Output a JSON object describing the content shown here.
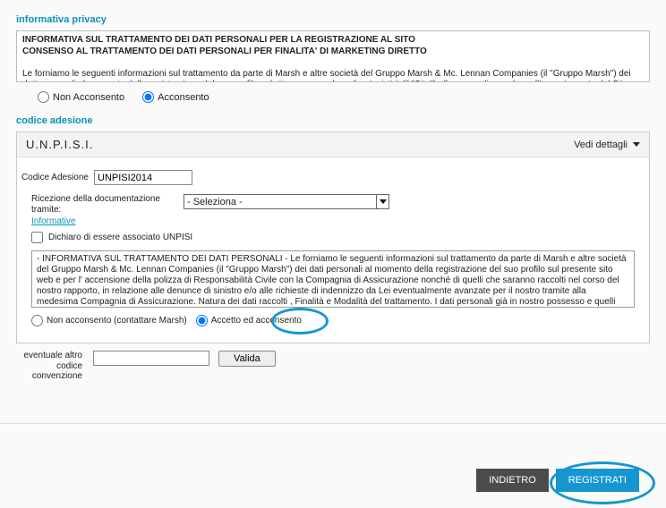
{
  "privacy_section": {
    "title": "informativa privacy",
    "heading1": "INFORMATIVA SUL TRATTAMENTO DEI DATI PERSONALI PER LA REGISTRAZIONE AL SITO",
    "heading2": "CONSENSO AL TRATTAMENTO DEI DATI PERSONALI PER FINALITA' DI MARKETING DIRETTO",
    "body": "Le forniamo le seguenti informazioni sul trattamento da parte di Marsh e altre società del Gruppo Marsh & Mc. Lennan Companies (il \"Gruppo Marsh\") dei dati personali al momento della registrazione del suo profilo sul sito www.marsh-professionisti.it (il \"Sito\") allo scopo di accedere all'area riservata del Sito e ottenere",
    "opt_no": "Non Acconsento",
    "opt_yes": "Acconsento"
  },
  "adesione_section": {
    "title": "codice adesione",
    "panel_title": "U.N.P.I.S.I.",
    "vedi_dettagli": "Vedi dettagli",
    "codice_label": "Codice Adesione",
    "codice_value": "UNPISI2014",
    "ricezione_label": "Ricezione della documentazione tramite:",
    "ricezione_value": "- Seleziona -",
    "informative": "Informative",
    "assoc_checkbox_label": "Dichiaro di essere associato UNPISI",
    "info_text": "- INFORMATIVA SUL TRATTAMENTO DEI DATI PERSONALI - Le forniamo le seguenti informazioni sul trattamento da parte di Marsh e altre società del Gruppo Marsh & Mc. Lennan Companies (il \"Gruppo Marsh\") dei dati personali al momento della registrazione del suo profilo sul presente sito web e per l' accensione della polizza di Responsabilità Civile con la Compagnia di Assicurazione nonché di quelli che saranno raccolti nel corso del nostro rapporto, in relazione alle denunce di sinistro e/o alle richieste di indennizzo da Lei eventualmente avanzate per il nostro tramite alla medesima Compagnia di Assicurazione. Natura dei dati raccolti , Finalità e Modalità del trattamento. I dati personali già in nostro possesso e quelli che di volta in volta Le",
    "opt2_no": "Non acconsento (contattare Marsh)",
    "opt2_yes": "Accetto ed acconsento"
  },
  "valida": {
    "label": "eventuale altro codice convenzione",
    "btn": "Valida"
  },
  "footer": {
    "back": "INDIETRO",
    "submit": "REGISTRATI"
  }
}
